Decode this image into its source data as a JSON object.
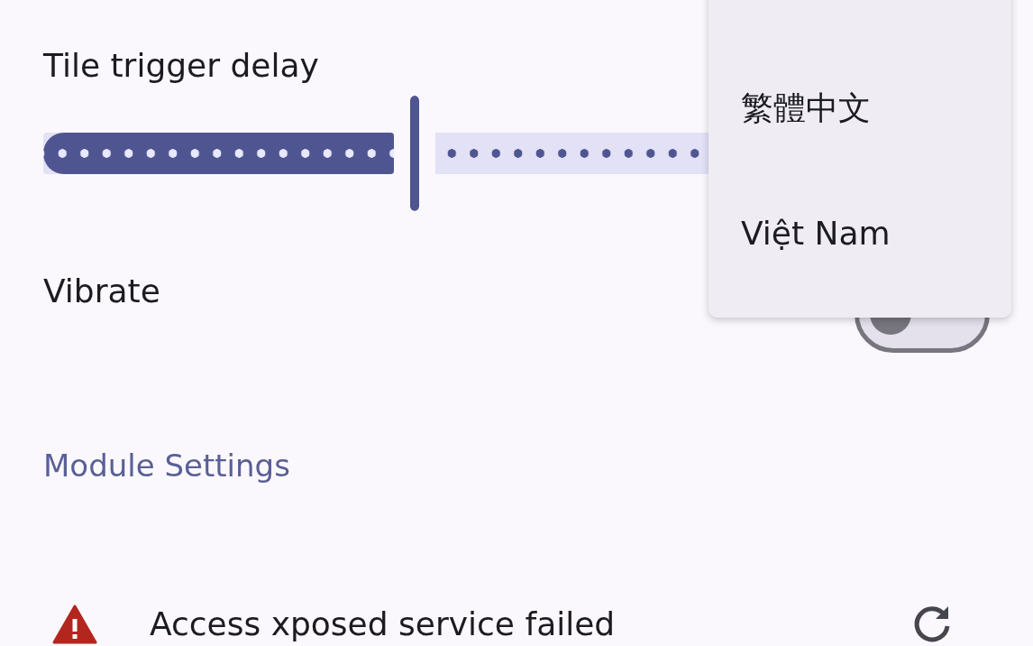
{
  "settings": [
    {
      "kind": "slider",
      "title": "Tile trigger delay",
      "level": 0.37
    },
    {
      "kind": "switch",
      "title": "Vibrate",
      "checked": false
    }
  ],
  "section_header": "Module Settings",
  "status_row": {
    "text": "Access xposed service failed"
  },
  "language_menu": {
    "items": [
      {
        "label": "繁體中文"
      },
      {
        "label": "Việt Nam"
      }
    ]
  }
}
